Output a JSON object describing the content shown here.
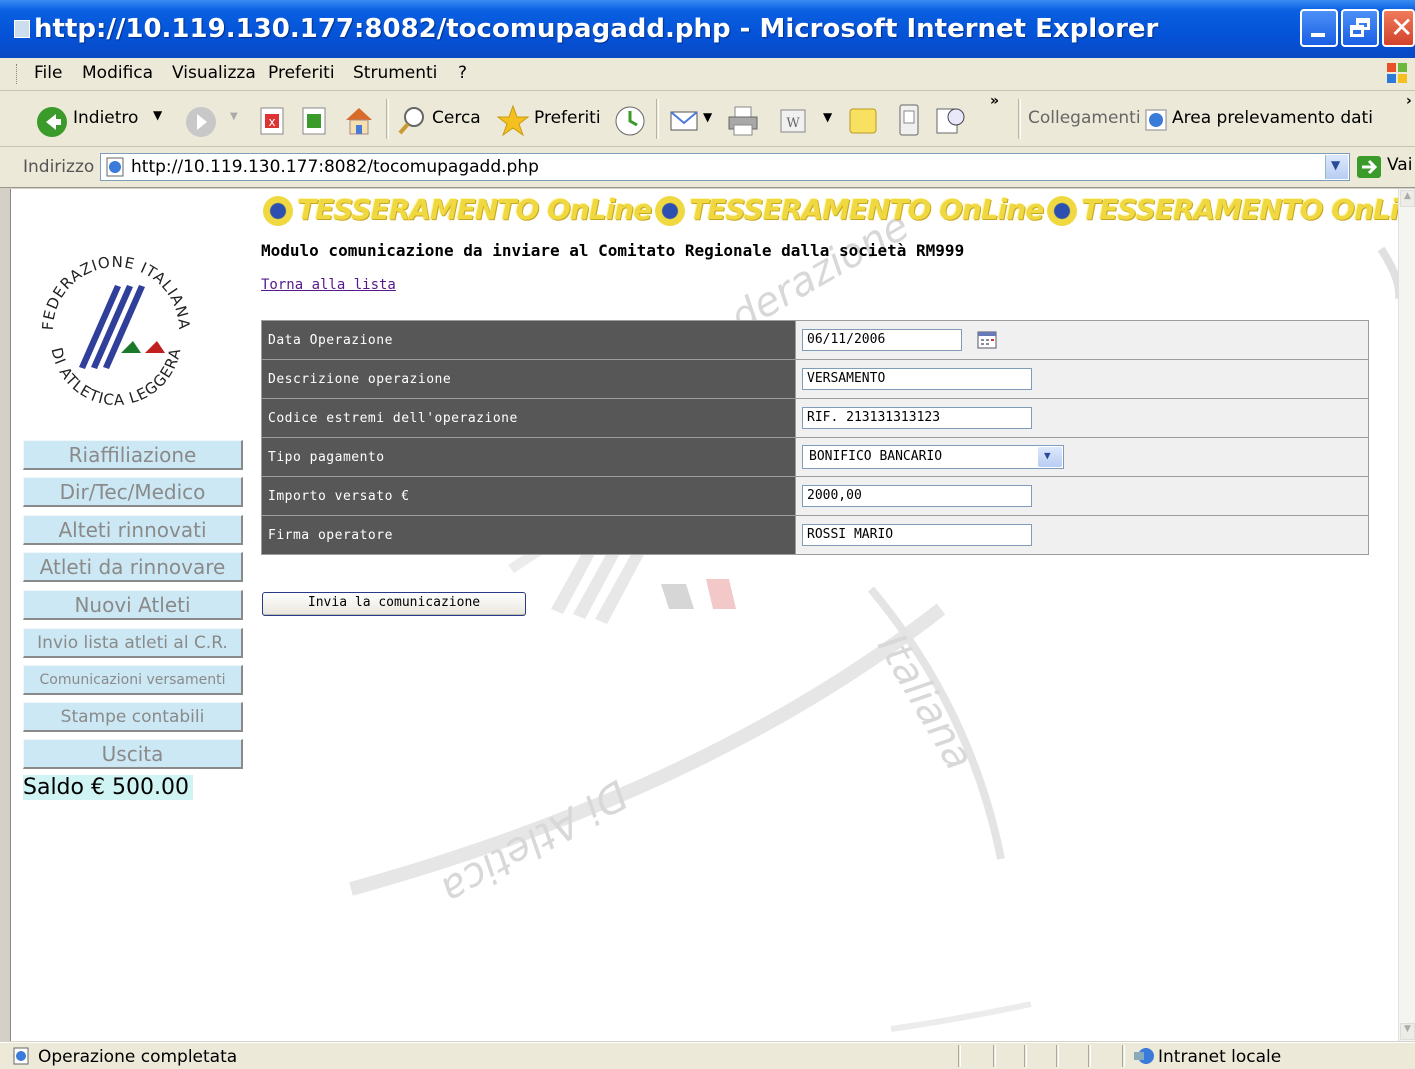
{
  "window": {
    "title": "http://10.119.130.177:8082/tocomupagadd.php - Microsoft Internet Explorer"
  },
  "menu": [
    "File",
    "Modifica",
    "Visualizza",
    "Preferiti",
    "Strumenti",
    "?"
  ],
  "toolbar": {
    "back_label": "Indietro",
    "search_label": "Cerca",
    "favorites_label": "Preferiti",
    "links_label": "Collegamenti",
    "download_area_label": "Area prelevamento dati"
  },
  "address": {
    "label": "Indirizzo",
    "url": "http://10.119.130.177:8082/tocomupagadd.php",
    "go_label": "Vai"
  },
  "page": {
    "banner_text": "TESSERAMENTO OnLine",
    "heading": "Modulo comunicazione da inviare al Comitato Regionale dalla società RM999",
    "back_link": "Torna alla lista",
    "logo_text_top": "FEDERAZIONE ITALIANA",
    "logo_text_bottom": "DI ATLETICA LEGGERA",
    "form": {
      "rows": [
        {
          "label": "Data Operazione",
          "value": "06/11/2006"
        },
        {
          "label": "Descrizione operazione",
          "value": "VERSAMENTO"
        },
        {
          "label": "Codice estremi dell'operazione",
          "value": "RIF. 213131313123"
        },
        {
          "label": "Tipo pagamento",
          "value": "BONIFICO BANCARIO"
        },
        {
          "label": "Importo versato €",
          "value": "2000,00"
        },
        {
          "label": "Firma operatore",
          "value": "ROSSI MARIO"
        }
      ]
    },
    "submit_label": "Invia la comunicazione",
    "nav": [
      "Riaffiliazione",
      "Dir/Tec/Medico",
      "Alteti rinnovati",
      "Atleti da rinnovare",
      "Nuovi Atleti",
      "Invio lista atleti al C.R.",
      "Comunicazioni versamenti",
      "Stampe contabili",
      "Uscita"
    ],
    "saldo": "Saldo € 500.00",
    "watermark": [
      "derazione",
      "Italiana",
      "Di Atletica"
    ]
  },
  "status": {
    "text": "Operazione completata",
    "zone": "Intranet locale"
  },
  "colors": {
    "titlebar": "#0553d8",
    "label_cell": "#575757",
    "nav_button": "#cce8f4",
    "banner": "#f0d840"
  }
}
